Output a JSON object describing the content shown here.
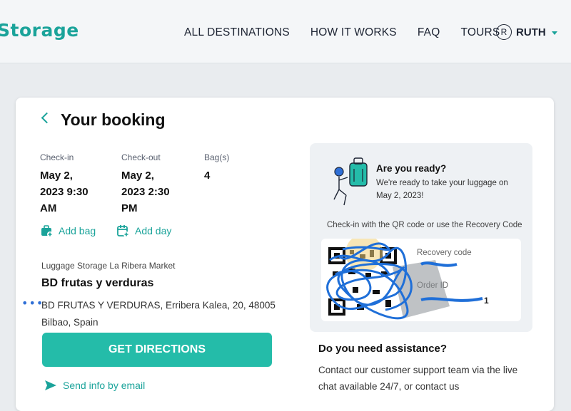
{
  "header": {
    "logo": "Storage",
    "nav": [
      "ALL DESTINATIONS",
      "HOW IT WORKS",
      "FAQ",
      "TOURS"
    ],
    "user_initial": "R",
    "user_name": "RUTH"
  },
  "booking": {
    "title": "Your booking",
    "checkin_label": "Check-in",
    "checkin_lines": [
      "May 2,",
      "2023 9:30",
      "AM"
    ],
    "checkout_label": "Check-out",
    "checkout_lines": [
      "May 2,",
      "2023 2:30",
      "PM"
    ],
    "bags_label": "Bag(s)",
    "bags_value": "4",
    "add_bag": "Add bag",
    "add_day": "Add day",
    "location_label": "Luggage Storage La Ribera Market",
    "location_name": "BD frutas y verduras",
    "address_lines": [
      "BD FRUTAS Y VERDURAS, Erribera Kalea, 20, 48005",
      "Bilbao, Spain"
    ],
    "directions_button": "GET DIRECTIONS",
    "email_link": "Send info by email"
  },
  "ready_panel": {
    "title": "Are you ready?",
    "text_lines": [
      "We're ready to take your luggage on",
      "May 2, 2023!"
    ],
    "checkin_note": "Check-in with the QR code or use the Recovery Code",
    "recovery_label": "Recovery code",
    "order_label": "Order ID",
    "order_value_visible": "1"
  },
  "assistance": {
    "title": "Do you need assistance?",
    "text_lines": [
      "Contact our customer support team via the live",
      "chat available 24/7, or contact us"
    ]
  },
  "colors": {
    "brand": "#1aa39a",
    "button": "#24bca9",
    "redaction": "#1f6fd8"
  }
}
